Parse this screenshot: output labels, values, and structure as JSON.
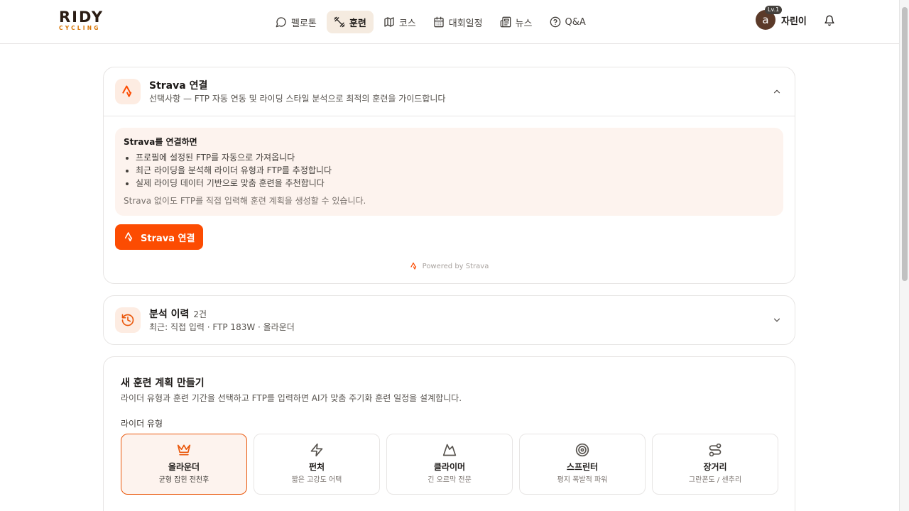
{
  "brand": {
    "name": "RIDY",
    "sub": "CYCLING"
  },
  "nav": [
    {
      "label": "펠로톤",
      "icon": "chat-bubble-icon",
      "active": false
    },
    {
      "label": "훈련",
      "icon": "dumbbell-icon",
      "active": true
    },
    {
      "label": "코스",
      "icon": "map-icon",
      "active": false
    },
    {
      "label": "대회일정",
      "icon": "calendar-icon",
      "active": false
    },
    {
      "label": "뉴스",
      "icon": "newspaper-icon",
      "active": false
    },
    {
      "label": "Q&A",
      "icon": "help-circle-icon",
      "active": false
    }
  ],
  "user": {
    "avatar": "a",
    "level": "Lv.1",
    "name": "자린이"
  },
  "strava": {
    "title": "Strava 연결",
    "subtitle": "선택사항 — FTP 자동 연동 및 라이딩 스타일 분석으로 최적의 훈련을 가이드합니다",
    "info_title": "Strava를 연결하면",
    "benefits": [
      "프로필에 설정된 FTP를 자동으로 가져옵니다",
      "최근 라이딩을 분석해 라이더 유형과 FTP를 추정합니다",
      "실제 라이딩 데이터 기반으로 맞춤 훈련을 추천합니다"
    ],
    "note": "Strava 없이도 FTP를 직접 입력해 훈련 계획을 생성할 수 있습니다.",
    "button": "Strava 연결",
    "powered": "Powered by Strava",
    "accent": "#fc4c02"
  },
  "history": {
    "title": "분석 이력",
    "count": "2건",
    "recent": "최근: 직접 입력 · FTP 183W · 올라운더"
  },
  "plan": {
    "title": "새 훈련 계획 만들기",
    "description": "라이더 유형과 훈련 기간을 선택하고 FTP를 입력하면 AI가 맞춤 주기화 훈련 일정을 설계합니다.",
    "rider_type_label": "라이더 유형",
    "types": [
      {
        "name": "올라운더",
        "desc": "균형 잡힌 전천후",
        "icon": "crown-icon",
        "selected": true
      },
      {
        "name": "펀처",
        "desc": "짧은 고강도 어택",
        "icon": "lightning-icon",
        "selected": false
      },
      {
        "name": "클라이머",
        "desc": "긴 오르막 전문",
        "icon": "mountain-icon",
        "selected": false
      },
      {
        "name": "스프린터",
        "desc": "평지 폭발적 파워",
        "icon": "target-icon",
        "selected": false
      },
      {
        "name": "장거리",
        "desc": "그란폰도 / 센추리",
        "icon": "route-icon",
        "selected": false
      }
    ]
  },
  "colors": {
    "accent": "#ea580c",
    "brand_dark": "#2b1d14",
    "brand_gold": "#d97706"
  }
}
